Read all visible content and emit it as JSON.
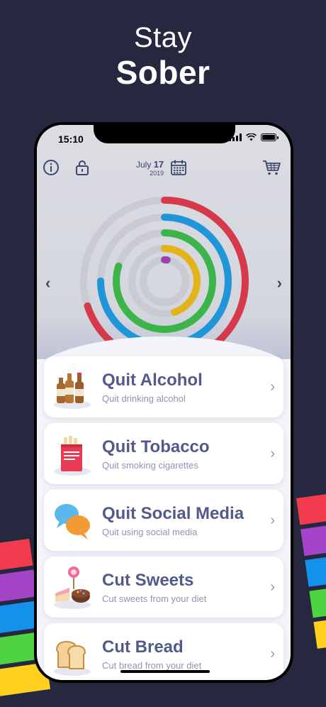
{
  "headline": {
    "line1": "Stay",
    "line2": "Sober"
  },
  "status": {
    "time": "15:10"
  },
  "header": {
    "date_month_day": "July",
    "date_day": "17",
    "date_year": "2019"
  },
  "icons": {
    "info": "info-icon",
    "lock": "lock-icon",
    "calendar": "calendar-icon",
    "cart": "cart-icon",
    "prev": "chevron-left-icon",
    "next": "chevron-right-icon"
  },
  "nav": {
    "prev": "‹",
    "next": "›"
  },
  "rings_progress": [
    {
      "color": "#d63a4a",
      "fraction": 0.7
    },
    {
      "color": "#1f96d8",
      "fraction": 0.75
    },
    {
      "color": "#3bb54a",
      "fraction": 0.8
    },
    {
      "color": "#e2b41a",
      "fraction": 0.45
    },
    {
      "color": "#9b3fb3",
      "fraction": 0.02
    }
  ],
  "items": [
    {
      "title": "Quit Alcohol",
      "subtitle": "Quit drinking alcohol",
      "chevron": "›"
    },
    {
      "title": "Quit Tobacco",
      "subtitle": "Quit smoking cigarettes",
      "chevron": "›"
    },
    {
      "title": "Quit Social Media",
      "subtitle": "Quit using social media",
      "chevron": "›"
    },
    {
      "title": "Cut Sweets",
      "subtitle": "Cut sweets from your diet",
      "chevron": "›"
    },
    {
      "title": "Cut Bread",
      "subtitle": "Cut bread from your diet",
      "chevron": "›"
    }
  ],
  "colors": {
    "background": "#262840",
    "stripe_red": "#f23b4f",
    "stripe_purple": "#a445c8",
    "stripe_blue": "#1491ea",
    "stripe_green": "#4fd340",
    "stripe_yellow": "#ffd11f"
  }
}
